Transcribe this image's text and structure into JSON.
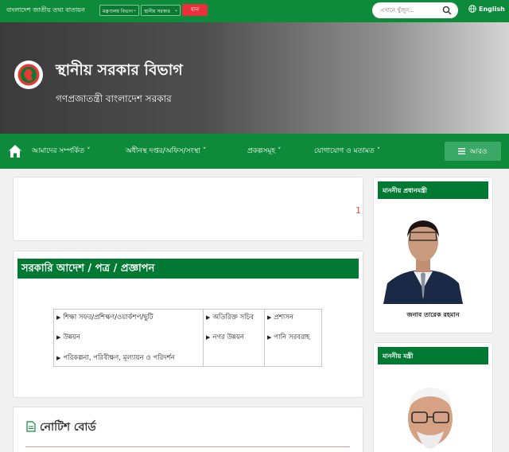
{
  "topbar": {
    "portal_name": "বাংলাদেশ জাতীয় তথ্য বাতায়ন",
    "select_office_type": "মন্ত্রণালয় বিভাগ",
    "select_office": "স্থানীয় সরকার",
    "go_label": "যান",
    "search_placeholder": "এখানে খুঁজুন...",
    "language": "English"
  },
  "banner": {
    "title": "স্থানীয় সরকার বিভাগ",
    "subtitle": "গণপ্রজাতন্ত্রী বাংলাদেশ সরকার"
  },
  "nav": {
    "items": [
      "আমাদের সম্পর্কিত ˅",
      "অধীনস্থ দপ্তর/অফিস/সংস্থা ˅",
      "প্রকল্পসমূহ ˅",
      "যোগাযোগ ও মতামত ˅"
    ],
    "more": "আরও"
  },
  "main": {
    "slider_counter": "1",
    "orders_title": "সরকারি আদেশ / পত্র / প্রজ্ঞাপন",
    "categories": {
      "col1": [
        "শিক্ষা সফর/প্রশিক্ষণ/ওয়ার্কশপ/ছুটি",
        "উন্নয়ন",
        "পরিকল্পনা, পরিবীক্ষণ, মূল্যায়ন ও পরিদর্শন"
      ],
      "col2": [
        "অতিরিক্ত সচিব",
        "নগর উন্নয়ন"
      ],
      "col3": [
        "প্রশাসন",
        "পানি সরবরাহ"
      ]
    },
    "notice_title": "নোটিশ বোর্ড"
  },
  "sidebar": {
    "pm_heading": "মাননীয় প্রধানমন্ত্রী",
    "pm_name": "জনাব তারেক রহমান",
    "minister_heading": "মাননীয় মন্ত্রী"
  },
  "icons": {
    "home": "home-icon",
    "search": "search-icon",
    "globe": "globe-icon",
    "menu": "menu-icon",
    "notice": "document-icon"
  },
  "colors": {
    "primary_green": "#0d8b3a",
    "dark_green": "#007a33",
    "go_red": "#e9303a"
  }
}
